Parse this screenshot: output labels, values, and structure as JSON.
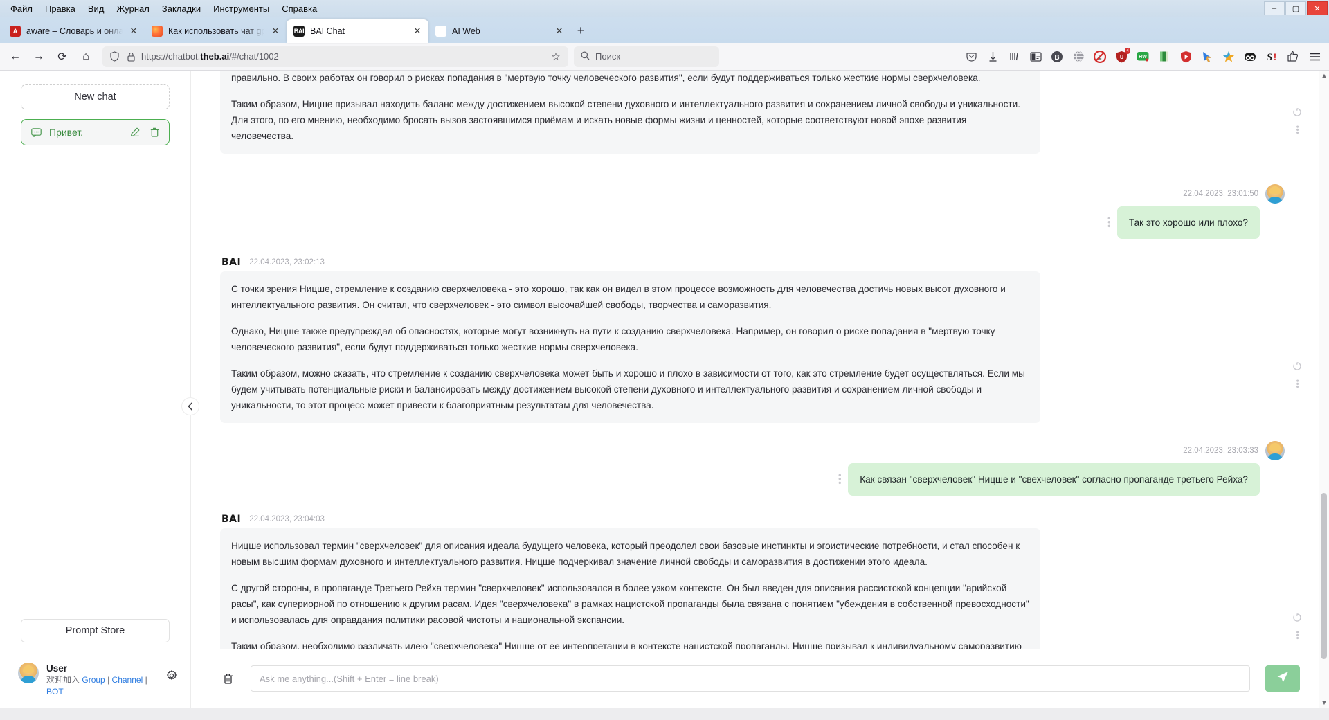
{
  "browser": {
    "menubar": [
      "Файл",
      "Правка",
      "Вид",
      "Журнал",
      "Закладки",
      "Инструменты",
      "Справка"
    ],
    "window_controls": {
      "minimize": "–",
      "maximize": "▢",
      "close": "✕"
    },
    "tabs": [
      {
        "title": "aware – Словарь и онлайн перевод",
        "favicon": "aware-icon",
        "active": false,
        "close": "✕"
      },
      {
        "title": "Как использовать чат gpt беспла",
        "favicon": "firefox-icon",
        "active": false,
        "close": "✕"
      },
      {
        "title": "BAI Chat",
        "favicon": "bai-icon",
        "active": true,
        "close": "✕"
      },
      {
        "title": "AI Web",
        "favicon": "openai-icon",
        "active": false,
        "close": "✕"
      }
    ],
    "new_tab_label": "+",
    "nav": {
      "back": "←",
      "forward": "→",
      "reload": "⟳",
      "home": "⌂"
    },
    "url": {
      "prefix": "https://chatbot.",
      "domain": "theb.ai",
      "path": "/#/chat/1002"
    },
    "bookmark_star": "☆",
    "search": {
      "placeholder": "Поиск",
      "icon": "search-icon"
    },
    "extensions": [
      {
        "name": "pocket-icon",
        "glyph": "⌄"
      },
      {
        "name": "downloads-icon",
        "glyph": "↓"
      },
      {
        "name": "library-icon",
        "glyph": "|||\\"
      },
      {
        "name": "reader-sidebar-icon",
        "glyph": "▤"
      },
      {
        "name": "bitwarden-icon",
        "glyph": "B"
      },
      {
        "name": "globe-translate-icon",
        "glyph": "🌐"
      },
      {
        "name": "adblock-icon",
        "glyph": "🚫"
      },
      {
        "name": "shield-guard-icon",
        "glyph": "🛡",
        "badge": "4"
      },
      {
        "name": "homework-icon",
        "glyph": "HW"
      },
      {
        "name": "notes-icon",
        "glyph": "📗"
      },
      {
        "name": "adguard-icon",
        "glyph": "🛡"
      },
      {
        "name": "pointer-icon",
        "glyph": "🖱"
      },
      {
        "name": "star-rating-icon",
        "glyph": "★"
      },
      {
        "name": "panda-icon",
        "glyph": "🐼"
      },
      {
        "name": "savefrom-icon",
        "glyph": "S!"
      },
      {
        "name": "thumbs-up-icon",
        "glyph": "👍"
      },
      {
        "name": "hamburger-menu-icon",
        "glyph": "☰"
      }
    ]
  },
  "sidebar": {
    "new_chat_label": "New chat",
    "chats": [
      {
        "title": "Привет.",
        "icon": "chat-bubble-icon",
        "edit_icon": "pencil-icon",
        "delete_icon": "trash-icon",
        "active": true
      }
    ],
    "prompt_store_label": "Prompt Store",
    "user": {
      "name": "User",
      "welcome_prefix": "欢迎加入",
      "links": [
        "Group",
        "Channel",
        "BOT"
      ],
      "separator": "|",
      "settings_icon": "gear-icon"
    },
    "collapse_icon": "chevron-left-icon"
  },
  "chat": {
    "brand": "BAI",
    "messages": [
      {
        "role": "assistant",
        "timestamp": "",
        "clipped_top": true,
        "paragraphs": [
          "Однако, Ницше также предупреждал о возможных негативных последствиях этого процесса, так как термин \"сверхчеловек\" может быть интерпретирован или использован не правильно. В своих работах он говорил о рисках попадания в \"мертвую точку человеческого развития\", если будут поддерживаться только жесткие нормы сверхчеловека.",
          "Таким образом, Ницше призывал находить баланс между достижением высокой степени духовного и интеллектуального развития и сохранением личной свободы и уникальности. Для этого, по его мнению, необходимо бросать вызов застоявшимся приёмам и искать новые формы жизни и ценностей, которые соответствуют новой эпохе развития человечества."
        ]
      },
      {
        "role": "user",
        "timestamp": "22.04.2023, 23:01:50",
        "text": "Так это хорошо или плохо?"
      },
      {
        "role": "assistant",
        "timestamp": "22.04.2023, 23:02:13",
        "paragraphs": [
          "С точки зрения Ницше, стремление к созданию сверхчеловека - это хорошо, так как он видел в этом процессе возможность для человечества достичь новых высот духовного и интеллектуального развития. Он считал, что сверхчеловек - это символ высочайшей свободы, творчества и саморазвития.",
          "Однако, Ницше также предупреждал об опасностях, которые могут возникнуть на пути к созданию сверхчеловека. Например, он говорил о риске попадания в \"мертвую точку человеческого развития\", если будут поддерживаться только жесткие нормы сверхчеловека.",
          "Таким образом, можно сказать, что стремление к созданию сверхчеловека может быть и хорошо и плохо в зависимости от того, как это стремление будет осуществляться. Если мы будем учитывать потенциальные риски и балансировать между достижением высокой степени духовного и интеллектуального развития и сохранением личной свободы и уникальности, то этот процесс может привести к благоприятным результатам для человечества."
        ]
      },
      {
        "role": "user",
        "timestamp": "22.04.2023, 23:03:33",
        "text": "Как связан \"сверхчеловек\" Ницше и \"свехчеловек\" согласно пропаганде третьего Рейха?"
      },
      {
        "role": "assistant",
        "timestamp": "22.04.2023, 23:04:03",
        "paragraphs": [
          "Ницше использовал термин \"сверхчеловек\" для описания идеала будущего человека, который преодолел свои базовые инстинкты и эгоистические потребности, и стал способен к новым высшим формам духовного и интеллектуального развития. Ницше подчеркивал значение личной свободы и саморазвития в достижении этого идеала.",
          "С другой стороны, в пропаганде Третьего Рейха термин \"сверхчеловек\" использовался в более узком контексте. Он был введен для описания рассистской концепции \"арийской расы\", как супериорной по отношению к другим расам. Идея \"сверхчеловека\" в рамках нацистской пропаганды была связана с понятием \"убеждения в собственной превосходности\" и использовалась для оправдания политики расовой чистоты и национальной экспансии.",
          "Таким образом, необходимо различать идею \"сверхчеловека\" Ницше от ее интерпретации в контексте нацистской пропаганды. Ницше призывал к индивидуальному саморазвитию и свободе, в то время как концепция \"сверхчеловека\" в рамках нацизма была использована в целях оправдания политики геноцида и экспансии."
        ]
      }
    ],
    "actions": {
      "copy_icon": "copy-icon",
      "more_icon": "more-vertical-icon"
    }
  },
  "composer": {
    "clear_icon": "trash-icon",
    "placeholder": "Ask me anything...(Shift + Enter = line break)",
    "value": "",
    "send_icon": "send-icon"
  },
  "scrollbar": {
    "up_arrow": "▲",
    "down_arrow": "▼"
  },
  "colors": {
    "accent_green": "#4caf50",
    "user_bubble": "#d7f2d7",
    "assistant_bubble": "#f5f6f7",
    "send_button": "#8bcf9a",
    "link_blue": "#2f7de1"
  }
}
